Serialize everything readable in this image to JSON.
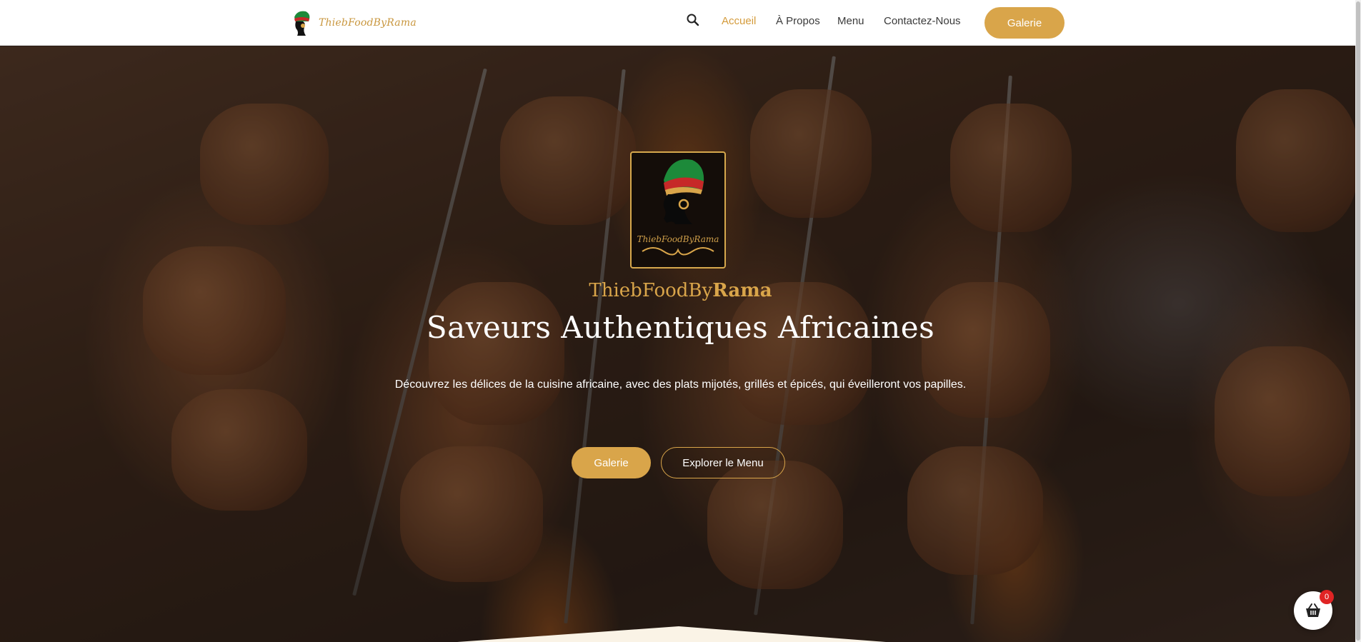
{
  "header": {
    "brand_name": "ThiebFoodByRama",
    "nav": [
      {
        "label": "Accueil",
        "active": true
      },
      {
        "label": "À Propos",
        "active": false
      },
      {
        "label": "Menu",
        "active": false
      },
      {
        "label": "Contactez-Nous",
        "active": false
      }
    ],
    "cta_label": "Galerie",
    "search_icon": "search-icon"
  },
  "hero": {
    "logo_text": "ThiebFoodByRama",
    "brand_prefix": "ThiebFoodBy",
    "brand_suffix": "Rama",
    "title": "Saveurs Authentiques Africaines",
    "subtitle": "Découvrez les délices de la cuisine africaine, avec des plats mijotés, grillés et épicés, qui éveilleront vos papilles.",
    "primary_button": "Galerie",
    "secondary_button": "Explorer le Menu"
  },
  "cart": {
    "icon": "basket-icon",
    "count": "0"
  },
  "colors": {
    "accent": "#d9a54a",
    "badge": "#e02424"
  }
}
